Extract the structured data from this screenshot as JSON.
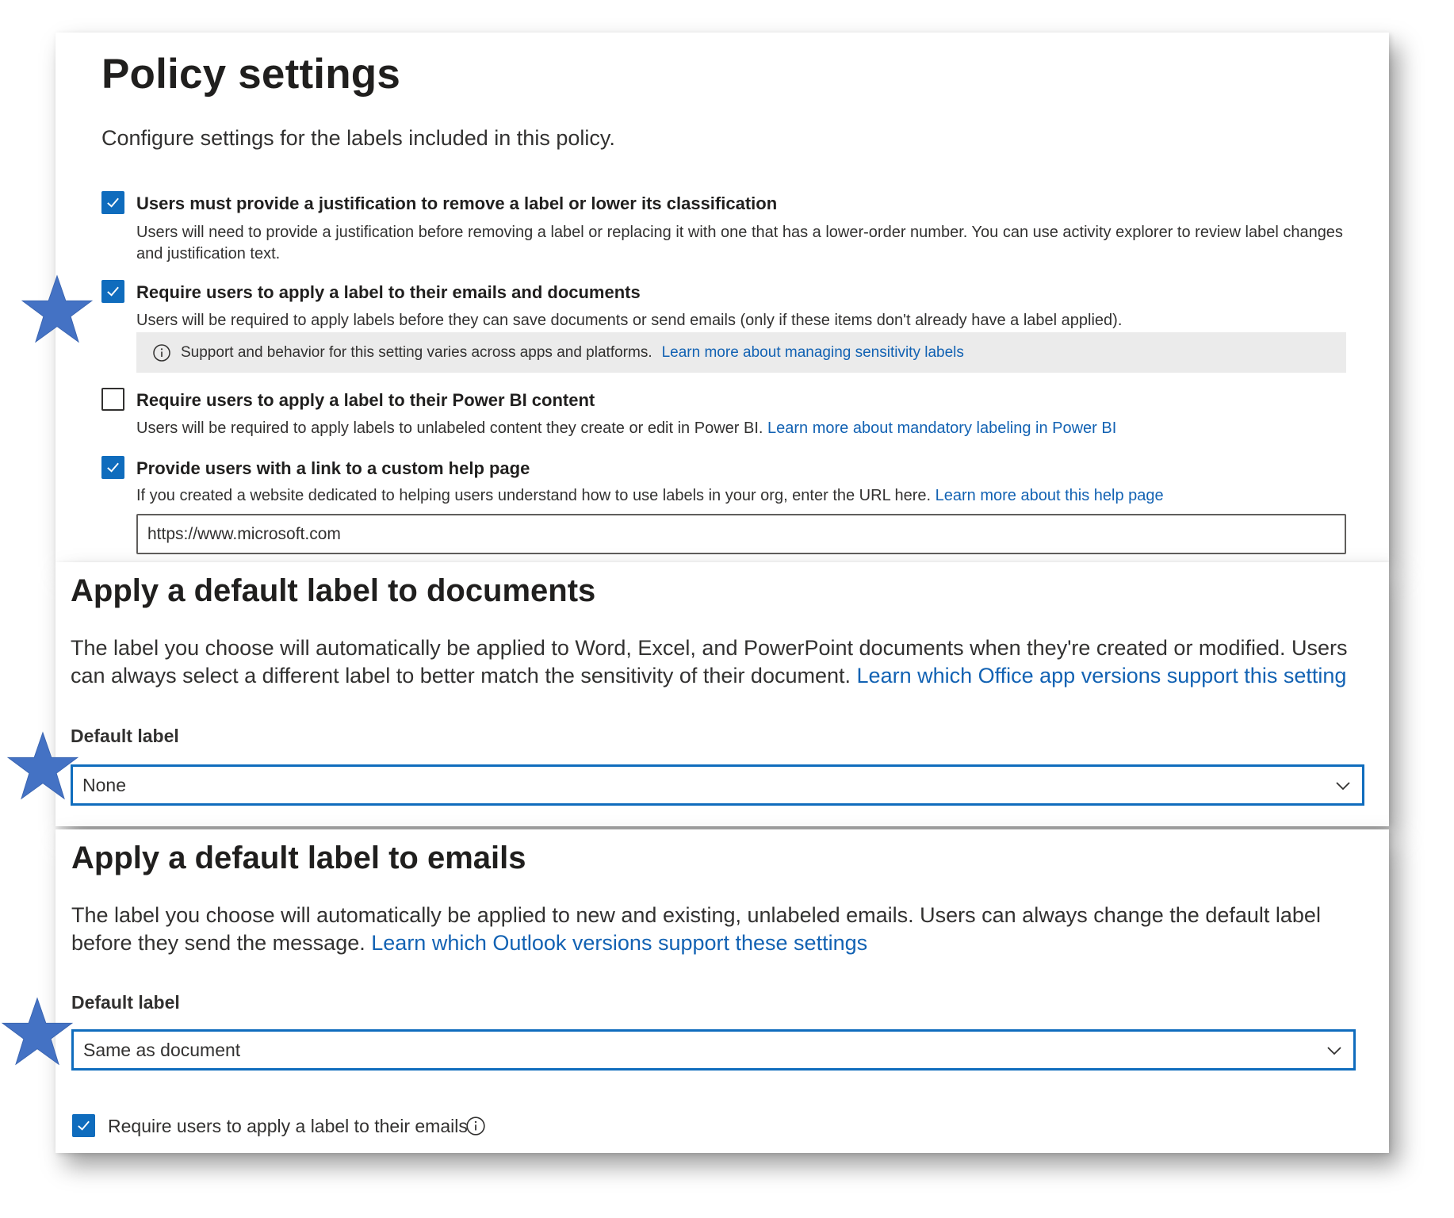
{
  "policy": {
    "title": "Policy settings",
    "subtitle": "Configure settings for the labels included in this policy.",
    "options": [
      {
        "checked": true,
        "title": "Users must provide a justification to remove a label or lower its classification",
        "description": "Users will need to provide a justification before removing a label or replacing it with one that has a lower-order number. You can use activity explorer to review label changes and justification text."
      },
      {
        "checked": true,
        "title": "Require users to apply a label to their emails and documents",
        "description": "Users will be required to apply labels before they can save documents or send emails (only if these items don't already have a label applied).",
        "info_text": "Support and behavior for this setting varies across apps and platforms.",
        "info_link": "Learn more about managing sensitivity labels"
      },
      {
        "checked": false,
        "title": "Require users to apply a label to their Power BI content",
        "description": "Users will be required to apply labels to unlabeled content they create or edit in Power BI.",
        "link": "Learn more about mandatory labeling in Power BI"
      },
      {
        "checked": true,
        "title": "Provide users with a link to a custom help page",
        "description": "If you created a website dedicated to helping users understand how to use labels in your org, enter the URL here.",
        "link": "Learn more about this help page",
        "url_value": "https://www.microsoft.com"
      }
    ]
  },
  "documents": {
    "title": "Apply a default label to documents",
    "description": "The label you choose will automatically be applied to Word, Excel, and PowerPoint documents when they're created or modified. Users can always select a different label to better match the sensitivity of their document.",
    "link": "Learn which Office app versions support this setting",
    "field_label": "Default label",
    "selected": "None"
  },
  "emails": {
    "title": "Apply a default label to emails",
    "description": "The label you choose will automatically be applied to new and existing, unlabeled emails. Users can always change the default label before they send the message.",
    "link": "Learn which Outlook versions support these settings",
    "field_label": "Default label",
    "selected": "Same as document",
    "require_checkbox_checked": true,
    "require_label": "Require users to apply a label to their emails"
  },
  "icons": {
    "checkbox_check": "checkmark-icon",
    "info": "info-icon",
    "dropdown": "chevron-down-icon",
    "annotation": "star-icon"
  },
  "colors": {
    "accent": "#0f6cbd",
    "link": "#1262b3",
    "star": "#4472c4",
    "info_bar": "#ebebeb"
  }
}
